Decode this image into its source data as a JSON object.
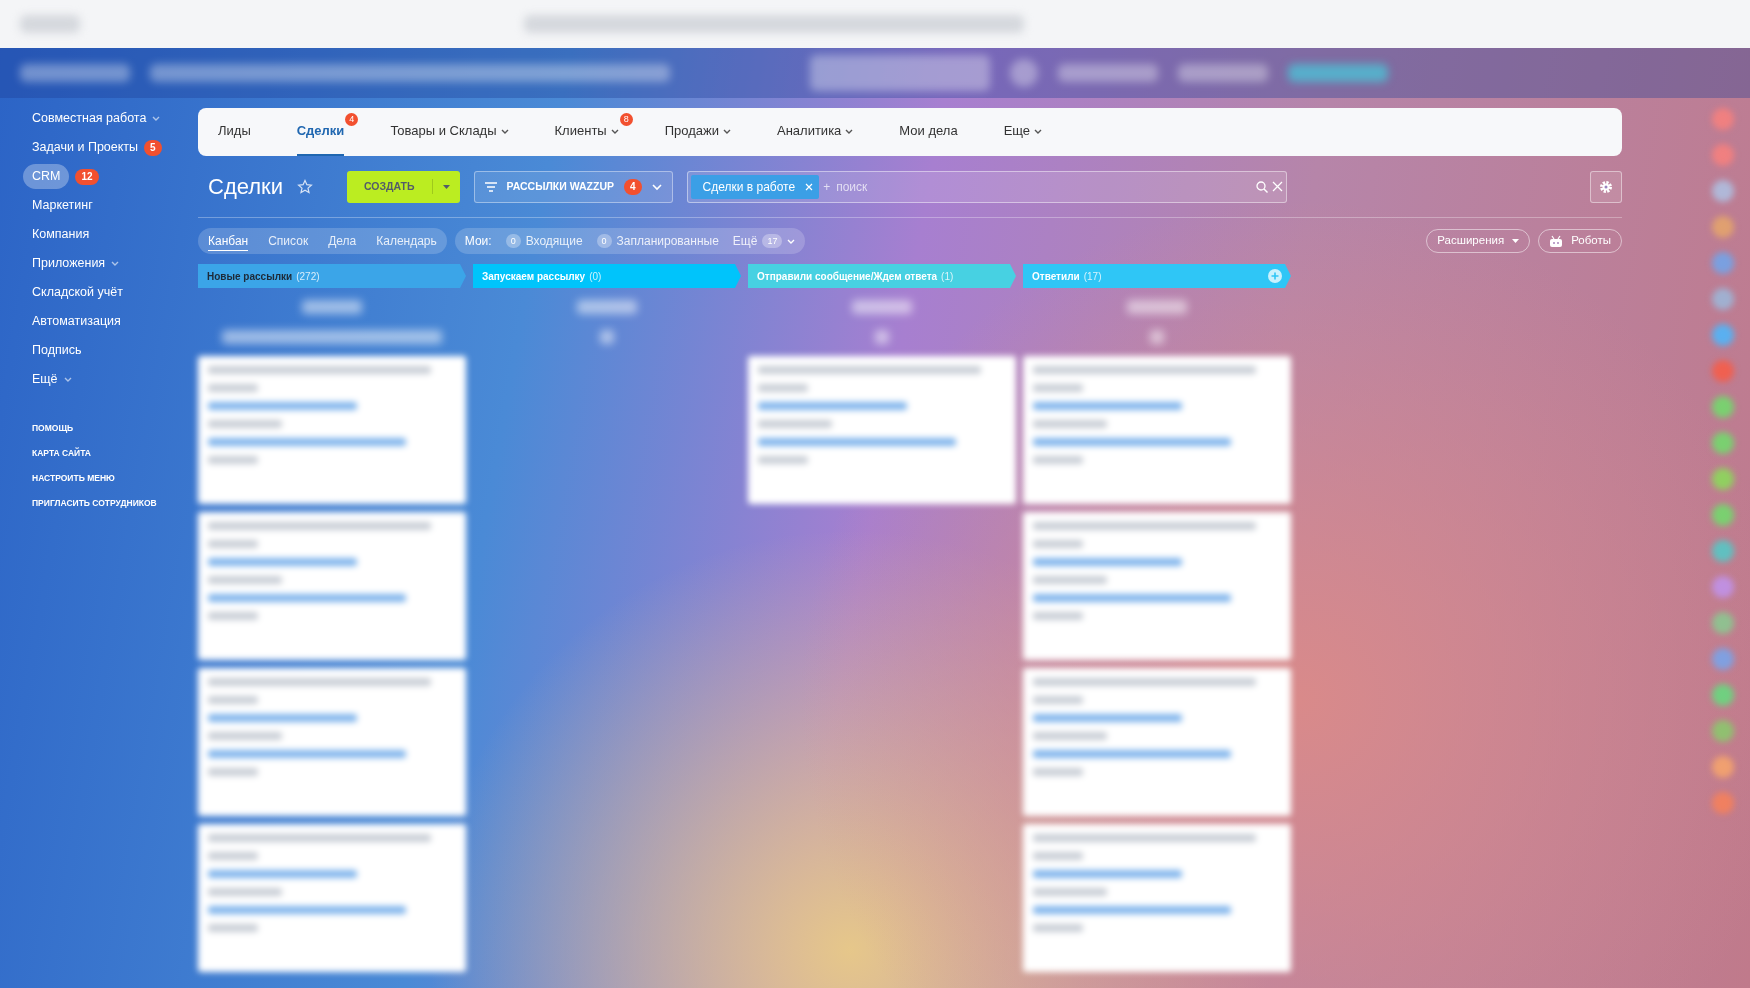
{
  "sidebar": {
    "items": [
      {
        "label": "Совместная работа",
        "dropdown": true,
        "selected": false
      },
      {
        "label": "Задачи и Проекты",
        "counter": "5",
        "selected": false
      },
      {
        "label": "CRM",
        "counter": "12",
        "selected": true
      },
      {
        "label": "Маркетинг",
        "selected": false
      },
      {
        "label": "Компания",
        "selected": false
      },
      {
        "label": "Приложения",
        "dropdown": true,
        "selected": false
      },
      {
        "label": "Складской учёт",
        "selected": false
      },
      {
        "label": "Автоматизация",
        "selected": false
      },
      {
        "label": "Подпись",
        "selected": false
      },
      {
        "label": "Ещё",
        "dropdown": true,
        "selected": false
      }
    ],
    "footer_links": [
      "ПОМОЩЬ",
      "КАРТА САЙТА",
      "НАСТРОИТЬ МЕНЮ",
      "ПРИГЛАСИТЬ СОТРУДНИКОВ"
    ]
  },
  "top_nav": [
    {
      "label": "Лиды",
      "selected": false
    },
    {
      "label": "Сделки",
      "counter": "4",
      "selected": true
    },
    {
      "label": "Товары и Склады",
      "dropdown": true,
      "selected": false
    },
    {
      "label": "Клиенты",
      "counter": "8",
      "dropdown": true,
      "selected": false
    },
    {
      "label": "Продажи",
      "dropdown": true,
      "selected": false
    },
    {
      "label": "Аналитика",
      "dropdown": true,
      "selected": false
    },
    {
      "label": "Мои дела",
      "selected": false
    },
    {
      "label": "Еще",
      "dropdown": true,
      "selected": false
    }
  ],
  "page_title": "Сделки",
  "create_button": "СОЗДАТЬ",
  "funnel": {
    "label": "РАССЫЛКИ WAZZUP",
    "counter": "4"
  },
  "search": {
    "chip": "Сделки в работе",
    "prefix": "+",
    "placeholder": "поиск"
  },
  "views": [
    {
      "label": "Канбан",
      "selected": true
    },
    {
      "label": "Список",
      "selected": false
    },
    {
      "label": "Дела",
      "selected": false
    },
    {
      "label": "Календарь",
      "selected": false
    }
  ],
  "my_filters": {
    "label": "Мои:",
    "items": [
      {
        "count": "0",
        "label": "Входящие"
      },
      {
        "count": "0",
        "label": "Запланированные"
      },
      {
        "count": "17",
        "label": "Ещё"
      }
    ]
  },
  "right_buttons": {
    "extensions": "Расширения",
    "robots": "Роботы"
  },
  "columns": [
    {
      "name": "Новые рассылки",
      "count": "(272)",
      "color": "#3ba5e8",
      "add_button": false,
      "cards": [
        {
          "kind": "deal"
        },
        {
          "kind": "deal"
        },
        {
          "kind": "deal"
        },
        {
          "kind": "deal"
        }
      ]
    },
    {
      "name": "Запускаем рассылку",
      "count": "(0)",
      "color": "#00c4fb",
      "add_button": false
    },
    {
      "name": "Отправили сообщение/Ждем ответа",
      "count": "(1)",
      "color": "#47d1e2",
      "add_button": false,
      "cards": [
        {
          "kind": "deal"
        }
      ]
    },
    {
      "name": "Ответили",
      "count": "(17)",
      "color": "#2fc6f6",
      "add_button": true,
      "cards": [
        {
          "kind": "deal"
        },
        {
          "kind": "deal"
        },
        {
          "kind": "deal"
        },
        {
          "kind": "deal"
        }
      ]
    }
  ]
}
